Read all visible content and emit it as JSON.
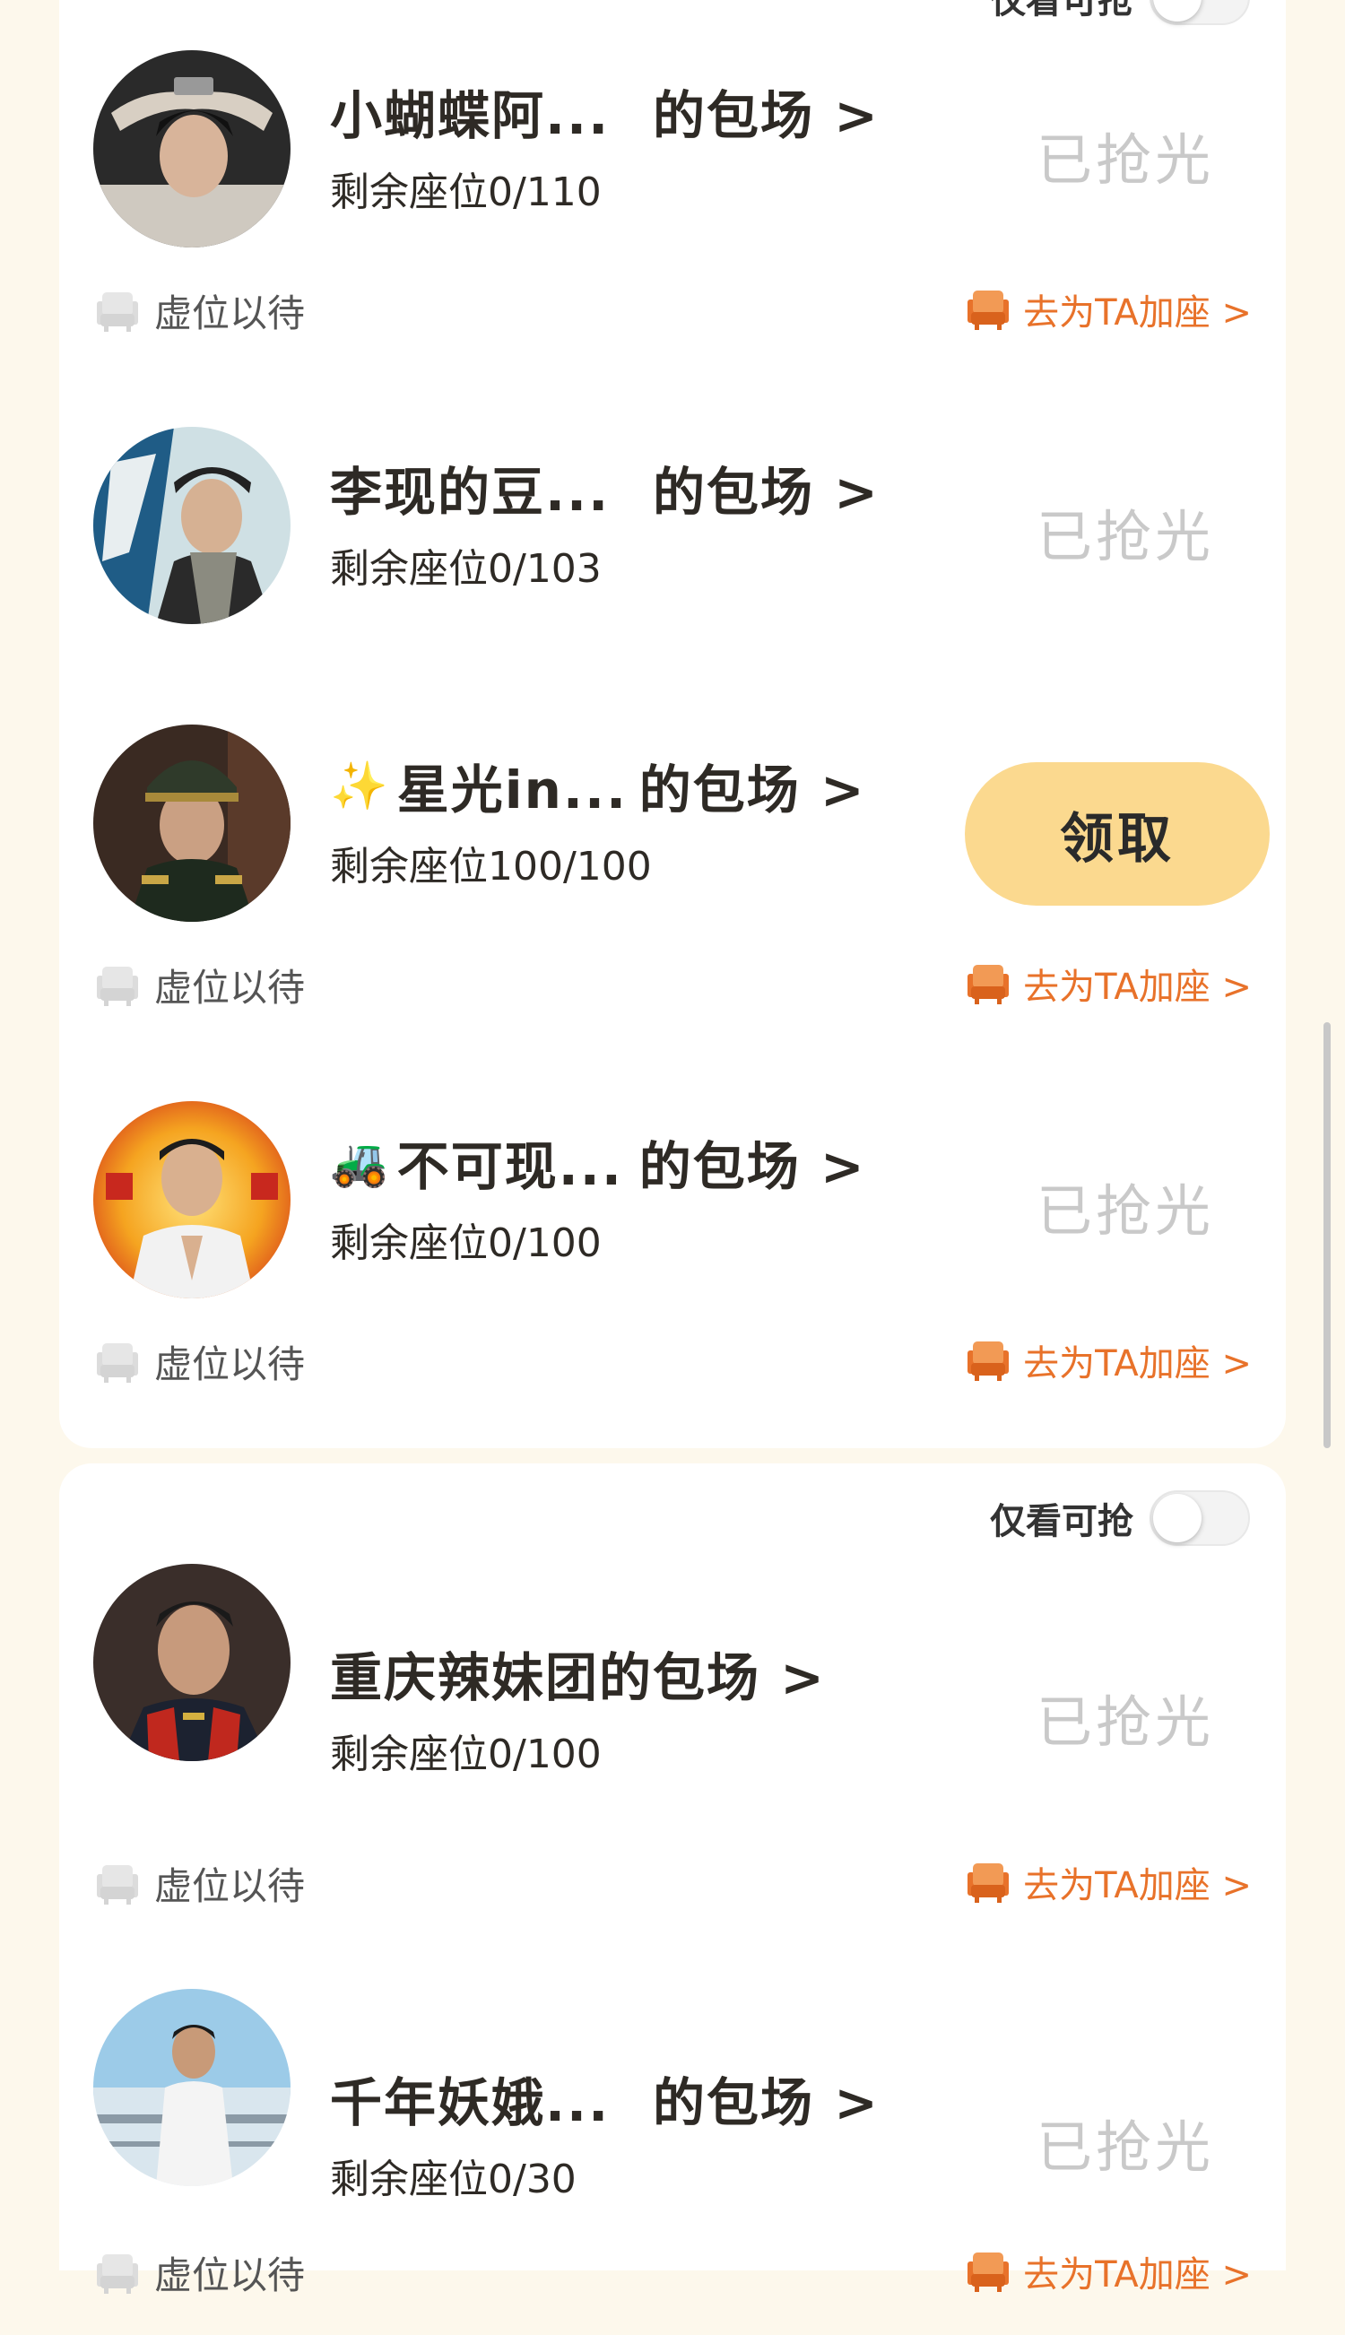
{
  "filter": {
    "label": "仅看可抢",
    "enabled": false
  },
  "entries": [
    {
      "emoji": "",
      "name": "小蝴蝶阿...",
      "suffix": "的包场 >",
      "seats": "剩余座位0/110",
      "status": "已抢光",
      "footer_left": "虚位以待",
      "footer_right": "去为TA加座 >"
    },
    {
      "emoji": "",
      "name": "李现的豆...",
      "suffix": "的包场 >",
      "seats": "剩余座位0/103",
      "status": "已抢光"
    },
    {
      "emoji": "✨",
      "name": "星光in...",
      "suffix": "的包场 >",
      "seats": "剩余座位100/100",
      "action": "领取",
      "footer_left": "虚位以待",
      "footer_right": "去为TA加座 >"
    },
    {
      "emoji": "🚜",
      "name": "不可现...",
      "suffix": "的包场 >",
      "seats": "剩余座位0/100",
      "status": "已抢光",
      "footer_left": "虚位以待",
      "footer_right": "去为TA加座 >"
    },
    {
      "emoji": "",
      "name": "重庆辣妹团",
      "suffix": "的包场 >",
      "seats": "剩余座位0/100",
      "status": "已抢光",
      "footer_left": "虚位以待",
      "footer_right": "去为TA加座 >"
    },
    {
      "emoji": "",
      "name": "千年妖娥...",
      "suffix": "的包场 >",
      "seats": "剩余座位0/30",
      "status": "已抢光",
      "footer_left": "虚位以待",
      "footer_right": "去为TA加座 >"
    }
  ],
  "colors": {
    "accent": "#e8722a",
    "claim_button": "#fbd98f",
    "sold_out_text": "#c9c9c9",
    "page_bg": "#fdf8ec"
  }
}
